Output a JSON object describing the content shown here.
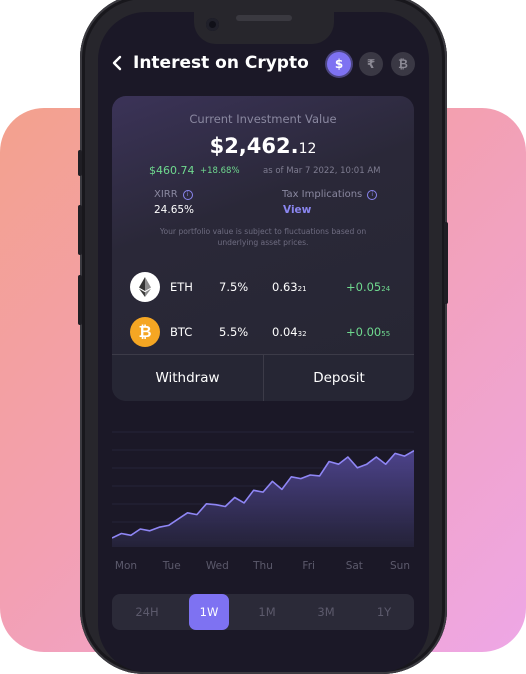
{
  "header": {
    "back_icon": "chevron-left-icon",
    "title": "Interest on Crypto",
    "currencies": [
      {
        "symbol": "$",
        "active": true
      },
      {
        "symbol": "₹",
        "active": false
      },
      {
        "symbol": "₿",
        "active": false
      }
    ]
  },
  "investment": {
    "label": "Current Investment Value",
    "value_main": "$2,462.",
    "value_cents": "12",
    "gain": "$460.74",
    "gain_pct": "+18.68%",
    "as_of": "as of Mar 7 2022, 10:01 AM",
    "xirr_label": "XIRR",
    "xirr_value": "24.65%",
    "tax_label": "Tax Implications",
    "tax_link": "View",
    "note": "Your portfolio value is subject to fluctuations based on underlying asset prices."
  },
  "coins": [
    {
      "name": "ETH",
      "rate": "7.5%",
      "amount_main": "0.63",
      "amount_small": "21",
      "change_main": "+0.05",
      "change_small": "24",
      "icon": "ethereum-icon"
    },
    {
      "name": "BTC",
      "rate": "5.5%",
      "amount_main": "0.04",
      "amount_small": "32",
      "change_main": "+0.00",
      "change_small": "55",
      "icon": "bitcoin-icon"
    }
  ],
  "actions": {
    "withdraw": "Withdraw",
    "deposit": "Deposit"
  },
  "chart_data": {
    "type": "area",
    "x": [
      "Mon",
      "Tue",
      "Wed",
      "Thu",
      "Fri",
      "Sat",
      "Sun"
    ],
    "values": [
      10,
      15,
      13,
      20,
      18,
      22,
      24,
      31,
      38,
      36,
      48,
      47,
      45,
      55,
      49,
      63,
      61,
      73,
      64,
      78,
      76,
      80,
      79,
      95,
      92,
      100,
      88,
      92,
      100,
      92,
      104,
      101,
      107
    ],
    "ylim": [
      0,
      130
    ],
    "grid": true,
    "colors": {
      "line": "#8f86f5",
      "fill_top": "#4f4590",
      "fill_bottom": "#25233a"
    }
  },
  "ranges": {
    "items": [
      "24H",
      "1W",
      "1M",
      "3M",
      "1Y"
    ],
    "active": "1W"
  }
}
